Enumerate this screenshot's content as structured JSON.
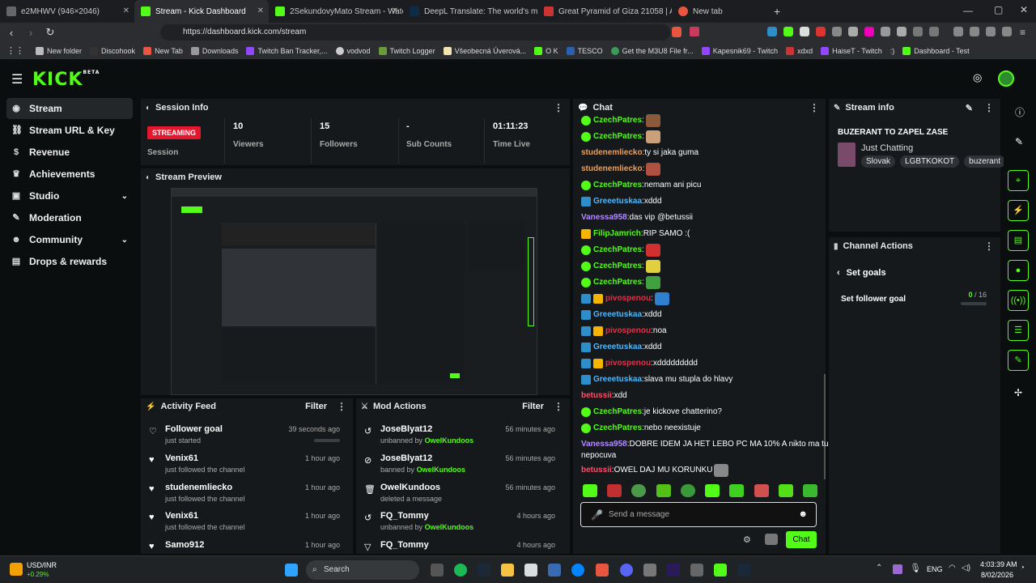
{
  "browser": {
    "tabs": [
      {
        "title": "e2MHWV (946×2046)",
        "active": false
      },
      {
        "title": "Stream - Kick Dashboard",
        "active": true
      },
      {
        "title": "2SekundovyMato Stream - Watch Liv",
        "active": false
      },
      {
        "title": "DeepL Translate: The world's most ac",
        "active": false
      },
      {
        "title": "Great Pyramid of Giza 21058 | Archit",
        "active": false
      },
      {
        "title": "New tab",
        "active": false
      }
    ],
    "url": "https://dashboard.kick.com/stream",
    "bookmarks": [
      "New folder",
      "Discohook",
      "New Tab",
      "Downloads",
      "Twitch Ban Tracker,...",
      "vodvod",
      "Twitch Logger",
      "Všeobecná Úverová...",
      "O K",
      "TESCO",
      "Get the M3U8 File fr...",
      "Kapesnik69 - Twitch",
      "xdxd",
      "HaiseT - Twitch",
      ":)",
      "Dashboard - Test"
    ]
  },
  "header": {
    "logo": "KICK",
    "logo_sup": "BETA"
  },
  "sidebar": {
    "items": [
      {
        "label": "Stream",
        "icon": "signal-icon",
        "active": true
      },
      {
        "label": "Stream URL & Key",
        "icon": "link-icon"
      },
      {
        "label": "Revenue",
        "icon": "dollar-icon"
      },
      {
        "label": "Achievements",
        "icon": "trophy-icon"
      },
      {
        "label": "Studio",
        "icon": "video-icon",
        "expand": true
      },
      {
        "label": "Moderation",
        "icon": "wrench-icon"
      },
      {
        "label": "Community",
        "icon": "users-icon",
        "expand": true
      },
      {
        "label": "Drops & rewards",
        "icon": "gift-icon"
      }
    ]
  },
  "session": {
    "title": "Session Info",
    "status_badge": "STREAMING",
    "session_label": "Session",
    "stats": [
      {
        "value": "10",
        "label": "Viewers"
      },
      {
        "value": "15",
        "label": "Followers"
      },
      {
        "value": "-",
        "label": "Sub Counts"
      },
      {
        "value": "01:11:23",
        "label": "Time Live"
      }
    ]
  },
  "preview": {
    "title": "Stream Preview"
  },
  "activity": {
    "title": "Activity Feed",
    "filter": "Filter",
    "items": [
      {
        "title": "Follower goal",
        "sub": "just started",
        "time": "39 seconds ago",
        "icon": "heart-outline-icon"
      },
      {
        "title": "Venix61",
        "sub": "just followed the channel",
        "time": "1 hour ago",
        "icon": "heart-icon"
      },
      {
        "title": "studenemliecko",
        "sub": "just followed the channel",
        "time": "1 hour ago",
        "icon": "heart-icon"
      },
      {
        "title": "Venix61",
        "sub": "just followed the channel",
        "time": "1 hour ago",
        "icon": "heart-icon"
      },
      {
        "title": "Samo912",
        "sub": "",
        "time": "1 hour ago",
        "icon": "heart-icon"
      }
    ],
    "goal_progress": 0.0
  },
  "mod": {
    "title": "Mod Actions",
    "filter": "Filter",
    "items": [
      {
        "title": "JoseBlyat12",
        "action": "unbanned by",
        "by": "OwelKundoos",
        "time": "56 minutes ago",
        "icon": "undo-icon"
      },
      {
        "title": "JoseBlyat12",
        "action": "banned by",
        "by": "OwelKundoos",
        "time": "56 minutes ago",
        "icon": "ban-icon"
      },
      {
        "title": "OwelKundoos",
        "action": "deleted a message",
        "by": "",
        "time": "56 minutes ago",
        "icon": "trash-icon"
      },
      {
        "title": "FQ_Tommy",
        "action": "unbanned by",
        "by": "OwelKundoos",
        "time": "4 hours ago",
        "icon": "undo-icon"
      },
      {
        "title": "FQ_Tommy",
        "action": "",
        "by": "",
        "time": "4 hours ago",
        "icon": "filter-icon"
      }
    ]
  },
  "chat": {
    "title": "Chat",
    "placeholder": "Send a message",
    "send_label": "Chat",
    "messages": [
      {
        "user": "CzechPatres",
        "color": "#53fc18",
        "badges": [
          "green"
        ],
        "text": "",
        "emote": "#8a5a3a"
      },
      {
        "user": "CzechPatres",
        "color": "#53fc18",
        "badges": [
          "green"
        ],
        "text": "",
        "emote": "#c9a07a"
      },
      {
        "user": "studenemliecko",
        "color": "#e8a060",
        "badges": [],
        "text": "ty si jaka guma",
        "emote": ""
      },
      {
        "user": "studenemliecko",
        "color": "#e8a060",
        "badges": [],
        "text": "",
        "emote": "#b05040"
      },
      {
        "user": "CzechPatres",
        "color": "#53fc18",
        "badges": [
          "green"
        ],
        "text": "nemam ani picu",
        "emote": ""
      },
      {
        "user": "Greeetuskaa",
        "color": "#4cb8ff",
        "badges": [
          "blue"
        ],
        "text": "xddd",
        "emote": ""
      },
      {
        "user": "Vanessa958",
        "color": "#b18cff",
        "badges": [],
        "text": "das vip @betussii",
        "emote": ""
      },
      {
        "user": "FilipJamrich",
        "color": "#53fc18",
        "badges": [
          "crown"
        ],
        "text": "RIP SAMO :(",
        "emote": ""
      },
      {
        "user": "CzechPatres",
        "color": "#53fc18",
        "badges": [
          "green"
        ],
        "text": "",
        "emote": "#d03030"
      },
      {
        "user": "CzechPatres",
        "color": "#53fc18",
        "badges": [
          "green"
        ],
        "text": "",
        "emote": "#e0d040"
      },
      {
        "user": "CzechPatres",
        "color": "#53fc18",
        "badges": [
          "green"
        ],
        "text": "",
        "emote": "#40a040"
      },
      {
        "user": "pivospenou",
        "color": "#e0304a",
        "badges": [
          "blue",
          "crown"
        ],
        "text": "",
        "emote": "#3080d0"
      },
      {
        "user": "Greeetuskaa",
        "color": "#4cb8ff",
        "badges": [
          "blue"
        ],
        "text": "xddd",
        "emote": ""
      },
      {
        "user": "pivospenou",
        "color": "#e0304a",
        "badges": [
          "blue",
          "crown"
        ],
        "text": "noa",
        "emote": ""
      },
      {
        "user": "Greeetuskaa",
        "color": "#4cb8ff",
        "badges": [
          "blue"
        ],
        "text": "xddd",
        "emote": ""
      },
      {
        "user": "pivospenou",
        "color": "#e0304a",
        "badges": [
          "blue",
          "crown"
        ],
        "text": "xddddddddd",
        "emote": ""
      },
      {
        "user": "Greeetuskaa",
        "color": "#4cb8ff",
        "badges": [
          "blue"
        ],
        "text": "slava mu stupla do hlavy",
        "emote": ""
      },
      {
        "user": "betussii",
        "color": "#ff4d6a",
        "badges": [],
        "text": "xdd",
        "emote": ""
      },
      {
        "user": "CzechPatres",
        "color": "#53fc18",
        "badges": [
          "green"
        ],
        "text": "je kickove chatterino?",
        "emote": ""
      },
      {
        "user": "CzechPatres",
        "color": "#53fc18",
        "badges": [
          "green"
        ],
        "text": "nebo neexistuje",
        "emote": ""
      },
      {
        "user": "Vanessa958",
        "color": "#b18cff",
        "badges": [],
        "text": "DOBRE IDEM JA HET LEBO PC MA 10% A nikto ma tu",
        "text2": "nepocuva",
        "emote": ""
      },
      {
        "user": "betussii",
        "color": "#ff4d6a",
        "badges": [],
        "text": "OWEL DAJ MU KORUNKU",
        "emote": "#888888"
      }
    ]
  },
  "stream_info": {
    "title": "Stream info",
    "stream_title": "BUZERANT TO ZAPEL ZASE",
    "category": "Just Chatting",
    "tags": [
      "Slovak",
      "LGBTKOKOT",
      "buzerant"
    ]
  },
  "channel_actions": {
    "title": "Channel Actions",
    "back_label": "Set goals",
    "goal_label": "Set follower goal",
    "goal_current": "0",
    "goal_target": "/ 16"
  },
  "taskbar": {
    "ticker": "USD/INR",
    "ticker_change": "+0.29%",
    "search": "Search",
    "lang": "ENG",
    "time": "4:03:39 AM",
    "date": "8/02/2026"
  },
  "colors": {
    "accent": "#53fc18",
    "streaming": "#e5172f"
  }
}
